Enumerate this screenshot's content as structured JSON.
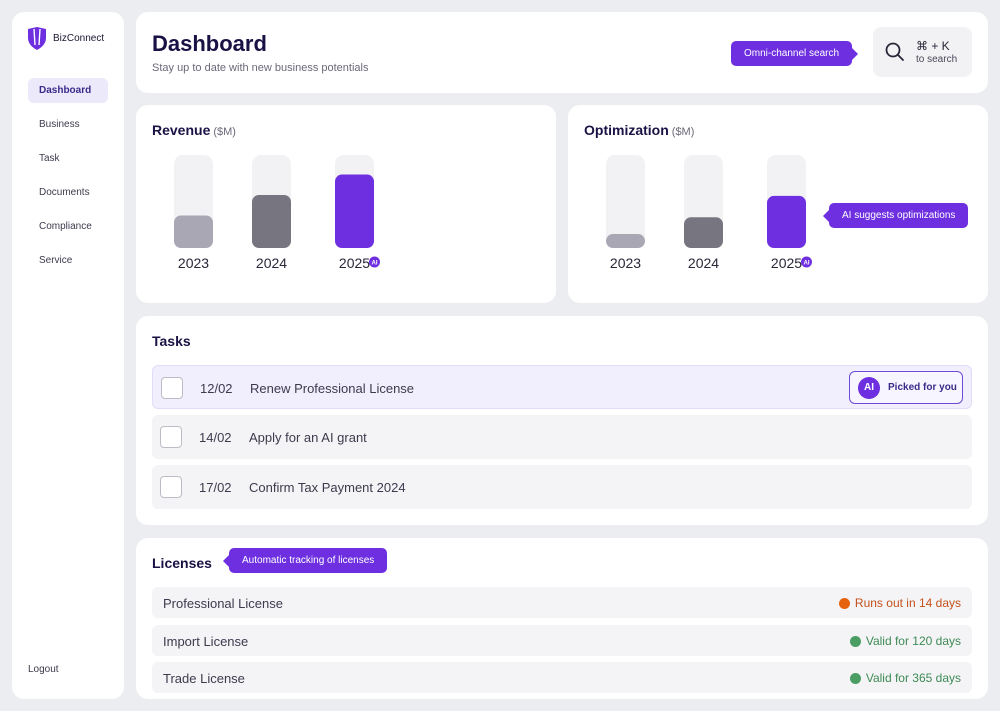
{
  "app": {
    "name": "BizConnect"
  },
  "colors": {
    "accent": "#6d2fe0",
    "bar_light": "#a9a7b4",
    "bar_dark": "#77757f",
    "bar_track": "#f2f2f4",
    "warning": "#e5620f",
    "ok": "#4a9d63"
  },
  "sidebar": {
    "items": [
      {
        "label": "Dashboard",
        "active": true
      },
      {
        "label": "Business"
      },
      {
        "label": "Task"
      },
      {
        "label": "Documents"
      },
      {
        "label": "Compliance"
      },
      {
        "label": "Service"
      }
    ],
    "logout_label": "Logout"
  },
  "header": {
    "title": "Dashboard",
    "subtitle": "Stay up to date with new business potentials",
    "search_tip": "Omni-channel search",
    "search_shortcut": "⌘ + K",
    "search_hint": "to search",
    "search_icon": "search-icon"
  },
  "revenue": {
    "title": "Revenue",
    "unit": "($M)"
  },
  "optimization": {
    "title": "Optimization",
    "unit": "($M)",
    "tip": "AI suggests optimizations"
  },
  "chart_data": [
    {
      "type": "bar",
      "title": "Revenue ($M)",
      "categories": [
        "2023",
        "2024",
        "2025"
      ],
      "values": [
        35,
        57,
        79
      ],
      "ylim": [
        0,
        100
      ],
      "ai_marked": [
        "2025"
      ],
      "grid": false
    },
    {
      "type": "bar",
      "title": "Optimization ($M)",
      "categories": [
        "2023",
        "2024",
        "2025"
      ],
      "values": [
        15,
        33,
        56
      ],
      "ylim": [
        0,
        100
      ],
      "ai_marked": [
        "2025"
      ],
      "grid": false
    }
  ],
  "tasks": {
    "title": "Tasks",
    "items": [
      {
        "date": "12/02",
        "title": "Renew Professional License",
        "picked": true
      },
      {
        "date": "14/02",
        "title": "Apply for an AI grant",
        "picked": false
      },
      {
        "date": "17/02",
        "title": "Confirm Tax Payment 2024",
        "picked": false
      }
    ],
    "picked_label": "Picked for you",
    "ai_badge": "AI"
  },
  "licenses": {
    "title": "Licenses",
    "tip": "Automatic tracking of licenses",
    "items": [
      {
        "name": "Professional License",
        "status": "Runs out in 14 days",
        "status_color": "#e5620f",
        "text_color": "#c4501a"
      },
      {
        "name": "Import License",
        "status": "Valid for 120 days",
        "status_color": "#4a9d63",
        "text_color": "#3e8a55"
      },
      {
        "name": "Trade License",
        "status": "Valid for 365 days",
        "status_color": "#4a9d63",
        "text_color": "#3e8a55"
      }
    ]
  }
}
